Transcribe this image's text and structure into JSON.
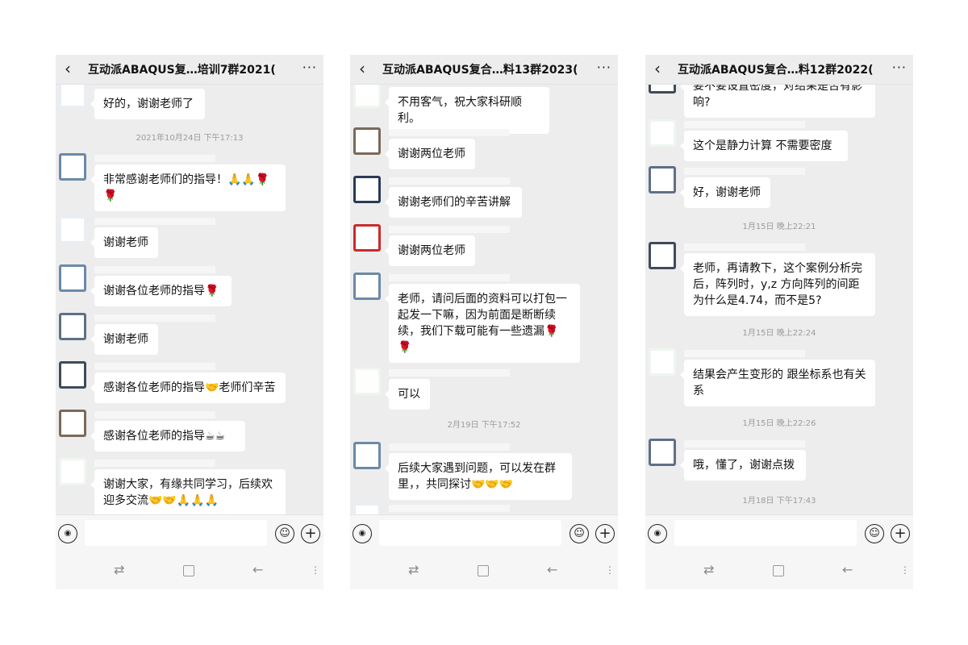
{
  "panels": [
    {
      "title": "互动派ABAQUS复…培训7群2021(　 )",
      "messages": [
        {
          "kind": "msg",
          "text": "好的，谢谢老师了"
        },
        {
          "kind": "time",
          "text": "2021年10月24日 下午17:13"
        },
        {
          "kind": "msg",
          "text": "非常感谢老师们的指导！🙏🙏🌹🌹"
        },
        {
          "kind": "msg",
          "text": "谢谢老师"
        },
        {
          "kind": "msg",
          "text": "谢谢各位老师的指导🌹"
        },
        {
          "kind": "msg",
          "text": "谢谢老师"
        },
        {
          "kind": "msg",
          "text": "感谢各位老师的指导🤝老师们辛苦"
        },
        {
          "kind": "msg",
          "text": "感谢各位老师的指导☕☕"
        },
        {
          "kind": "msg",
          "text": "谢谢大家，有缘共同学习，后续欢迎多交流🤝🤝🙏🙏🙏"
        }
      ]
    },
    {
      "title": "互动派ABAQUS复合…料13群2023(　 )",
      "messages": [
        {
          "kind": "msg",
          "text": "不用客气，祝大家科研顺利。"
        },
        {
          "kind": "msg",
          "text": "谢谢两位老师"
        },
        {
          "kind": "msg",
          "text": "谢谢老师们的辛苦讲解"
        },
        {
          "kind": "msg",
          "text": "谢谢两位老师"
        },
        {
          "kind": "msg",
          "text": "老师，请问后面的资料可以打包一起发一下嘛，因为前面是断断续续，我们下载可能有一些遗漏🌹🌹"
        },
        {
          "kind": "msg",
          "text": "可以"
        },
        {
          "kind": "time",
          "text": "2月19日 下午17:52"
        },
        {
          "kind": "msg",
          "text": "后续大家遇到问题，可以发在群里，，共同探讨🤝🤝🤝"
        }
      ]
    },
    {
      "title": "互动派ABAQUS复合…料12群2022(　 )",
      "messages": [
        {
          "kind": "msg",
          "text": "要不要设置密度，对结果是否有影响?"
        },
        {
          "kind": "msg",
          "text": "这个是静力计算 不需要密度"
        },
        {
          "kind": "msg",
          "text": "好，谢谢老师"
        },
        {
          "kind": "time",
          "text": "1月15日 晚上22:21"
        },
        {
          "kind": "msg",
          "text": "老师，再请教下，这个案例分析完后，阵列时，y,z 方向阵列的间距为什么是4.74，而不是5?"
        },
        {
          "kind": "time",
          "text": "1月15日 晚上22:24"
        },
        {
          "kind": "msg",
          "text": "结果会产生变形的 跟坐标系也有关系"
        },
        {
          "kind": "time",
          "text": "1月15日 晚上22:26"
        },
        {
          "kind": "msg",
          "text": "哦，懂了，谢谢点拨"
        },
        {
          "kind": "time",
          "text": "1月18日 下午17:43"
        }
      ]
    }
  ],
  "icons": {
    "back": "‹",
    "more": "···",
    "voice": "◉",
    "emoji": "☺",
    "add": "+",
    "nav_switch": "⇄",
    "nav_back": "←",
    "nav_menu": "⋮"
  }
}
